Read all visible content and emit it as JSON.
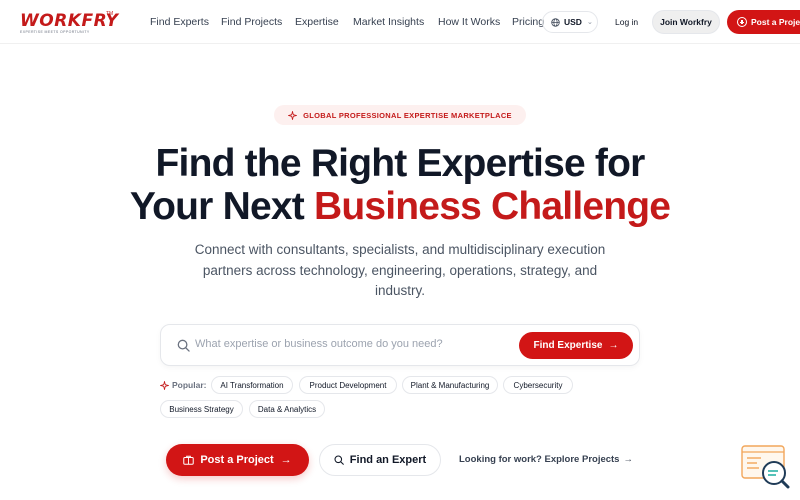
{
  "brand": {
    "name": "WORKFRY",
    "tm": "TM",
    "tagline": "EXPERTISE MEETS OPPORTUNITY",
    "accent_color": "#d21515"
  },
  "nav": {
    "links": [
      "Find Experts",
      "Find Projects",
      "Expertise",
      "Market Insights",
      "How It Works",
      "Pricing"
    ],
    "currency": "USD",
    "login": "Log in",
    "join": "Join Workfry",
    "post_project": "Post a Project"
  },
  "hero": {
    "badge": "GLOBAL PROFESSIONAL EXPERTISE MARKETPLACE",
    "headline_line1": "Find the Right Expertise for",
    "headline_line2_plain": "Your Next ",
    "headline_line2_accent": "Business Challenge",
    "subtext": "Connect with consultants, specialists, and multidisciplinary execution partners across technology, engineering, operations, strategy, and industry."
  },
  "search": {
    "placeholder": "What expertise or business outcome do you need?",
    "value": "",
    "button": "Find Expertise"
  },
  "popular": {
    "label": "Popular:",
    "tags": [
      "AI Transformation",
      "Product Development",
      "Plant & Manufacturing",
      "Cybersecurity",
      "Business Strategy",
      "Data & Analytics"
    ]
  },
  "cta": {
    "post_project": "Post a Project",
    "find_expert": "Find an Expert",
    "explore_link": "Looking for work? Explore Projects"
  },
  "icons": {
    "currency": "globe-icon",
    "badge": "sparkle-icon",
    "search": "search-icon",
    "post": "briefcase-icon",
    "expert": "search-icon",
    "arrow": "arrow-right-icon",
    "widget": "chat-search-widget-icon"
  }
}
